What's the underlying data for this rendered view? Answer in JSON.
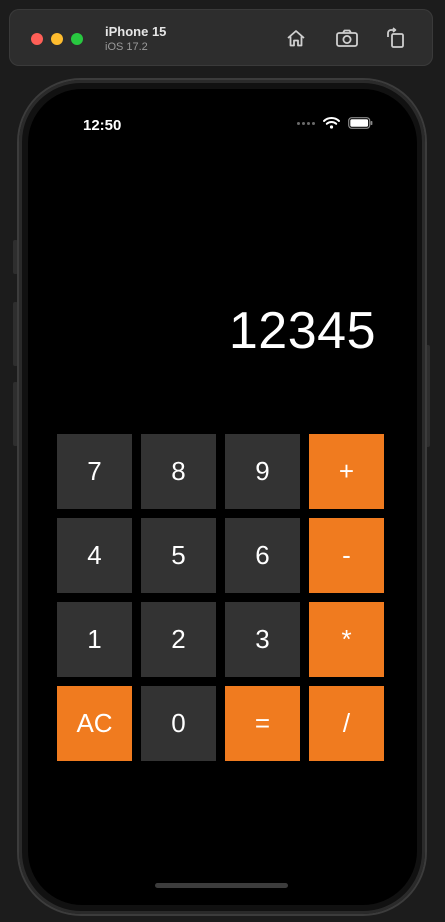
{
  "toolbar": {
    "device_name": "iPhone 15",
    "os_version": "iOS 17.2"
  },
  "status_bar": {
    "time": "12:50"
  },
  "calculator": {
    "display_value": "12345",
    "keys": [
      {
        "label": "7",
        "type": "digit"
      },
      {
        "label": "8",
        "type": "digit"
      },
      {
        "label": "9",
        "type": "digit"
      },
      {
        "label": "+",
        "type": "operator"
      },
      {
        "label": "4",
        "type": "digit"
      },
      {
        "label": "5",
        "type": "digit"
      },
      {
        "label": "6",
        "type": "digit"
      },
      {
        "label": "-",
        "type": "operator"
      },
      {
        "label": "1",
        "type": "digit"
      },
      {
        "label": "2",
        "type": "digit"
      },
      {
        "label": "3",
        "type": "digit"
      },
      {
        "label": "*",
        "type": "operator"
      },
      {
        "label": "AC",
        "type": "operator"
      },
      {
        "label": "0",
        "type": "digit"
      },
      {
        "label": "=",
        "type": "operator"
      },
      {
        "label": "/",
        "type": "operator"
      }
    ]
  },
  "colors": {
    "digit_key": "#333333",
    "operator_key": "#f07b1f",
    "screen_background": "#000000"
  }
}
